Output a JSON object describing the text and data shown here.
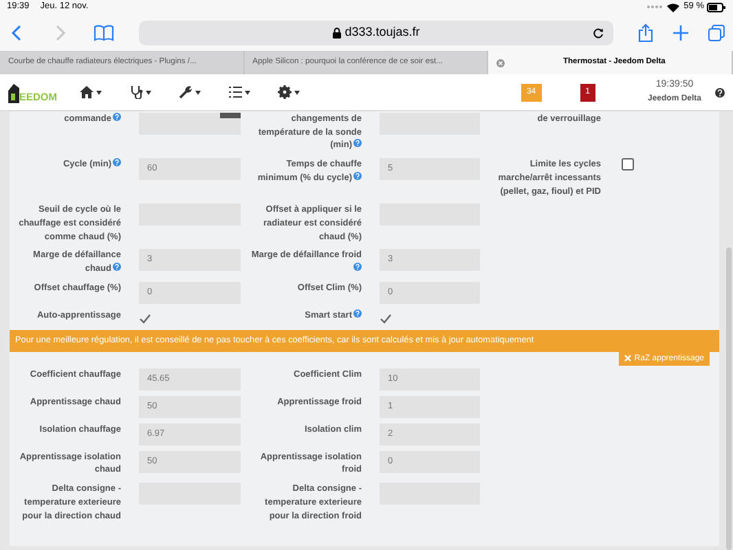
{
  "status_bar": {
    "time": "19:39",
    "date": "Jeu. 12 nov.",
    "battery": "59 %"
  },
  "browser": {
    "url": "d333.toujas.fr",
    "tabs": [
      {
        "title": "Courbe de chauffe radiateurs électriques - Plugins /...",
        "selected": false
      },
      {
        "title": "Apple Silicon : pourquoi la conférence de ce soir est...",
        "selected": false
      },
      {
        "title": "Thermostat - Jeedom Delta",
        "selected": true
      }
    ]
  },
  "navbar": {
    "logo": "EEDOM",
    "menus": [
      {
        "kind": "home"
      },
      {
        "kind": "health"
      },
      {
        "kind": "tools"
      },
      {
        "kind": "list"
      },
      {
        "kind": "settings"
      }
    ],
    "message_count": "34",
    "alert_count": "1",
    "clock": "19:39:50",
    "box_name": "Jeedom Delta"
  },
  "form_rows": [
    {
      "cells": [
        {
          "kind": "label",
          "text": "commande",
          "help": true
        },
        {
          "kind": "input",
          "addon": true
        },
        {
          "kind": "label",
          "text": "changements de température de la sonde (min)",
          "help": true
        },
        {
          "kind": "input"
        },
        {
          "kind": "label",
          "text": "de verrouillage"
        }
      ]
    },
    {
      "cells": [
        {
          "kind": "label",
          "text": "Cycle (min)",
          "help": true
        },
        {
          "kind": "input",
          "value": "60"
        },
        {
          "kind": "label",
          "text": "Temps de chauffe minimum (% du cycle)",
          "help": true
        },
        {
          "kind": "input",
          "value": "5"
        },
        {
          "kind": "label",
          "text": "Limite les cycles marche/arrêt incessants (pellet, gaz, fioul) et PID"
        },
        {
          "kind": "checkbox",
          "checked": false
        }
      ]
    },
    {
      "cells": [
        {
          "kind": "label",
          "text": "Seuil de cycle où le chauffage est considéré comme chaud (%)"
        },
        {
          "kind": "input"
        },
        {
          "kind": "label",
          "text": "Offset à appliquer si le radiateur est considéré chaud (%)"
        },
        {
          "kind": "input"
        }
      ]
    },
    {
      "cells": [
        {
          "kind": "label",
          "text": "Marge de défaillance chaud",
          "help": true
        },
        {
          "kind": "input",
          "value": "3"
        },
        {
          "kind": "label",
          "text": "Marge de défaillance froid",
          "help": true
        },
        {
          "kind": "input",
          "value": "3"
        }
      ]
    },
    {
      "cells": [
        {
          "kind": "label",
          "text": "Offset chauffage (%)"
        },
        {
          "kind": "input",
          "value": "0"
        },
        {
          "kind": "label",
          "text": "Offset Clim (%)"
        },
        {
          "kind": "input",
          "value": "0"
        }
      ]
    },
    {
      "cells": [
        {
          "kind": "label",
          "text": "Auto-apprentissage"
        },
        {
          "kind": "checkbox",
          "checked": true
        },
        {
          "kind": "label",
          "text": "Smart start",
          "help": true
        },
        {
          "kind": "checkbox",
          "checked": true
        }
      ]
    }
  ],
  "notice": "Pour une meilleure régulation, il est conseillé de ne pas toucher à ces coefficients, car ils sont calculés et mis à jour automatiquement",
  "reset_button": "RaZ apprentissage",
  "coef_rows": [
    {
      "cells": [
        {
          "kind": "label",
          "text": "Coefficient chauffage"
        },
        {
          "kind": "input",
          "value": "45.65"
        },
        {
          "kind": "label",
          "text": "Coefficient Clim"
        },
        {
          "kind": "input",
          "value": "10"
        }
      ]
    },
    {
      "cells": [
        {
          "kind": "label",
          "text": "Apprentissage chaud"
        },
        {
          "kind": "input",
          "value": "50"
        },
        {
          "kind": "label",
          "text": "Apprentissage froid"
        },
        {
          "kind": "input",
          "value": "1"
        }
      ]
    },
    {
      "cells": [
        {
          "kind": "label",
          "text": "Isolation chauffage"
        },
        {
          "kind": "input",
          "value": "6.97"
        },
        {
          "kind": "label",
          "text": "Isolation clim"
        },
        {
          "kind": "input",
          "value": "2"
        }
      ]
    },
    {
      "cells": [
        {
          "kind": "label",
          "text": "Apprentissage isolation chaud"
        },
        {
          "kind": "input",
          "value": "50"
        },
        {
          "kind": "label",
          "text": "Apprentissage isolation froid"
        },
        {
          "kind": "input",
          "value": "0"
        }
      ]
    },
    {
      "cells": [
        {
          "kind": "label",
          "text": "Delta consigne - temperature exterieure pour la direction chaud"
        },
        {
          "kind": "input"
        },
        {
          "kind": "label",
          "text": "Delta consigne - temperature exterieure pour la direction froid"
        },
        {
          "kind": "input"
        }
      ]
    }
  ]
}
